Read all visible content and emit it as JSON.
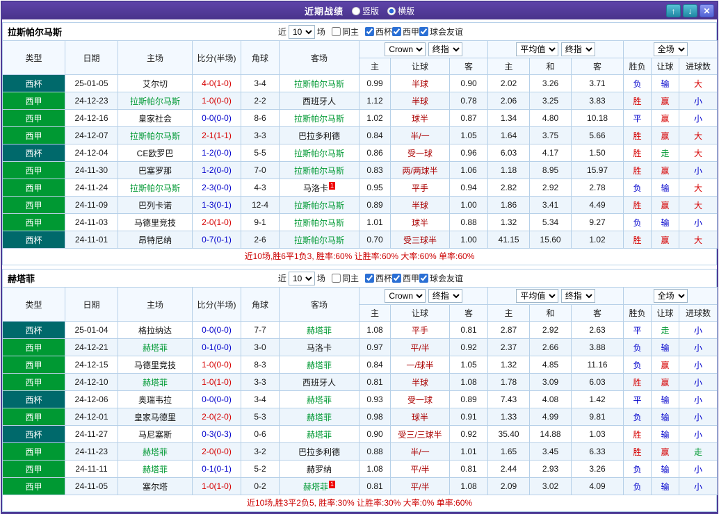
{
  "topbar": {
    "title": "近期战绩",
    "vertical_label": "竖版",
    "horizontal_label": "横版",
    "selected_layout": "横版",
    "up_icon": "↑",
    "down_icon": "↓",
    "close_icon": "✕"
  },
  "controls": {
    "near_label": "近",
    "count": "10",
    "matches_label": "场",
    "same_home_label": "同主",
    "filter_labels": [
      "西杯",
      "西甲",
      "球会友谊"
    ]
  },
  "table_header": {
    "type": "类型",
    "date": "日期",
    "home": "主场",
    "score": "比分(半场)",
    "corners": "角球",
    "away": "客场",
    "company": "Crown",
    "final": "终指",
    "average": "平均值",
    "fulltime": "全场",
    "sub_columns": [
      "主",
      "让球",
      "客",
      "主",
      "和",
      "客",
      "胜负",
      "让球",
      "进球数"
    ]
  },
  "colors": {
    "topbar_purple": "#52399b",
    "cup_badge": "#00696b",
    "liga_badge": "#009933",
    "focal_team": "#009933",
    "win_red": "#d60000",
    "loss_blue": "#0000cc",
    "push_green": "#009933",
    "handicap_red": "#aa0000",
    "row_alt": "#edf5fc",
    "grid": "#b6d0e8"
  },
  "sections": [
    {
      "team": "拉斯帕尔马斯",
      "summary": "近10场,胜6平1负3, 胜率:60% 让胜率:60% 大率:60% 单率:60%",
      "rows": [
        {
          "type": "西杯",
          "league": "cup",
          "date": "25-01-05",
          "home": "艾尔切",
          "home_focal": false,
          "score": "4-0(1-0)",
          "score_color": "red",
          "corners": "3-4",
          "away": "拉斯帕尔马斯",
          "away_focal": true,
          "odds": [
            "0.99",
            "半球",
            "0.90",
            "2.02",
            "3.26",
            "3.71"
          ],
          "results": [
            [
              "负",
              "blue"
            ],
            [
              "输",
              "blue"
            ],
            [
              "大",
              "red"
            ]
          ]
        },
        {
          "type": "西甲",
          "league": "liga",
          "date": "24-12-23",
          "home": "拉斯帕尔马斯",
          "home_focal": true,
          "score": "1-0(0-0)",
          "score_color": "red",
          "corners": "2-2",
          "away": "西班牙人",
          "away_focal": false,
          "odds": [
            "1.12",
            "半球",
            "0.78",
            "2.06",
            "3.25",
            "3.83"
          ],
          "results": [
            [
              "胜",
              "red"
            ],
            [
              "赢",
              "red"
            ],
            [
              "小",
              "blue"
            ]
          ]
        },
        {
          "type": "西甲",
          "league": "liga",
          "date": "24-12-16",
          "home": "皇家社会",
          "home_focal": false,
          "score": "0-0(0-0)",
          "score_color": "blue",
          "corners": "8-6",
          "away": "拉斯帕尔马斯",
          "away_focal": true,
          "odds": [
            "1.02",
            "球半",
            "0.87",
            "1.34",
            "4.80",
            "10.18"
          ],
          "results": [
            [
              "平",
              "blue"
            ],
            [
              "赢",
              "red"
            ],
            [
              "小",
              "blue"
            ]
          ]
        },
        {
          "type": "西甲",
          "league": "liga",
          "date": "24-12-07",
          "home": "拉斯帕尔马斯",
          "home_focal": true,
          "score": "2-1(1-1)",
          "score_color": "red",
          "corners": "3-3",
          "away": "巴拉多利德",
          "away_focal": false,
          "odds": [
            "0.84",
            "半/一",
            "1.05",
            "1.64",
            "3.75",
            "5.66"
          ],
          "results": [
            [
              "胜",
              "red"
            ],
            [
              "赢",
              "red"
            ],
            [
              "大",
              "red"
            ]
          ]
        },
        {
          "type": "西杯",
          "league": "cup",
          "date": "24-12-04",
          "home": "CE欧罗巴",
          "home_focal": false,
          "score": "1-2(0-0)",
          "score_color": "blue",
          "corners": "5-5",
          "away": "拉斯帕尔马斯",
          "away_focal": true,
          "odds": [
            "0.86",
            "受一球",
            "0.96",
            "6.03",
            "4.17",
            "1.50"
          ],
          "results": [
            [
              "胜",
              "red"
            ],
            [
              "走",
              "green"
            ],
            [
              "大",
              "red"
            ]
          ]
        },
        {
          "type": "西甲",
          "league": "liga",
          "date": "24-11-30",
          "home": "巴塞罗那",
          "home_focal": false,
          "score": "1-2(0-0)",
          "score_color": "blue",
          "corners": "7-0",
          "away": "拉斯帕尔马斯",
          "away_focal": true,
          "odds": [
            "0.83",
            "两/两球半",
            "1.06",
            "1.18",
            "8.95",
            "15.97"
          ],
          "results": [
            [
              "胜",
              "red"
            ],
            [
              "赢",
              "red"
            ],
            [
              "小",
              "blue"
            ]
          ]
        },
        {
          "type": "西甲",
          "league": "liga",
          "date": "24-11-24",
          "home": "拉斯帕尔马斯",
          "home_focal": true,
          "score": "2-3(0-0)",
          "score_color": "blue",
          "corners": "4-3",
          "away": "马洛卡",
          "away_focal": false,
          "away_red": "1",
          "odds": [
            "0.95",
            "平手",
            "0.94",
            "2.82",
            "2.92",
            "2.78"
          ],
          "results": [
            [
              "负",
              "blue"
            ],
            [
              "输",
              "blue"
            ],
            [
              "大",
              "red"
            ]
          ]
        },
        {
          "type": "西甲",
          "league": "liga",
          "date": "24-11-09",
          "home": "巴列卡诺",
          "home_focal": false,
          "score": "1-3(0-1)",
          "score_color": "blue",
          "corners": "12-4",
          "away": "拉斯帕尔马斯",
          "away_focal": true,
          "odds": [
            "0.89",
            "半球",
            "1.00",
            "1.86",
            "3.41",
            "4.49"
          ],
          "results": [
            [
              "胜",
              "red"
            ],
            [
              "赢",
              "red"
            ],
            [
              "大",
              "red"
            ]
          ]
        },
        {
          "type": "西甲",
          "league": "liga",
          "date": "24-11-03",
          "home": "马德里竞技",
          "home_focal": false,
          "score": "2-0(1-0)",
          "score_color": "red",
          "corners": "9-1",
          "away": "拉斯帕尔马斯",
          "away_focal": true,
          "odds": [
            "1.01",
            "球半",
            "0.88",
            "1.32",
            "5.34",
            "9.27"
          ],
          "results": [
            [
              "负",
              "blue"
            ],
            [
              "输",
              "blue"
            ],
            [
              "小",
              "blue"
            ]
          ]
        },
        {
          "type": "西杯",
          "league": "cup",
          "date": "24-11-01",
          "home": "昂特尼纳",
          "home_focal": false,
          "score": "0-7(0-1)",
          "score_color": "blue",
          "corners": "2-6",
          "away": "拉斯帕尔马斯",
          "away_focal": true,
          "odds": [
            "0.70",
            "受三球半",
            "1.00",
            "41.15",
            "15.60",
            "1.02"
          ],
          "results": [
            [
              "胜",
              "red"
            ],
            [
              "赢",
              "red"
            ],
            [
              "大",
              "red"
            ]
          ]
        }
      ]
    },
    {
      "team": "赫塔菲",
      "summary": "近10场,胜3平2负5, 胜率:30% 让胜率:30% 大率:0% 单率:60%",
      "rows": [
        {
          "type": "西杯",
          "league": "cup",
          "date": "25-01-04",
          "home": "格拉纳达",
          "home_focal": false,
          "score": "0-0(0-0)",
          "score_color": "blue",
          "corners": "7-7",
          "away": "赫塔菲",
          "away_focal": true,
          "odds": [
            "1.08",
            "平手",
            "0.81",
            "2.87",
            "2.92",
            "2.63"
          ],
          "results": [
            [
              "平",
              "blue"
            ],
            [
              "走",
              "green"
            ],
            [
              "小",
              "blue"
            ]
          ]
        },
        {
          "type": "西甲",
          "league": "liga",
          "date": "24-12-21",
          "home": "赫塔菲",
          "home_focal": true,
          "score": "0-1(0-0)",
          "score_color": "blue",
          "corners": "3-0",
          "away": "马洛卡",
          "away_focal": false,
          "odds": [
            "0.97",
            "平/半",
            "0.92",
            "2.37",
            "2.66",
            "3.88"
          ],
          "results": [
            [
              "负",
              "blue"
            ],
            [
              "输",
              "blue"
            ],
            [
              "小",
              "blue"
            ]
          ]
        },
        {
          "type": "西甲",
          "league": "liga",
          "date": "24-12-15",
          "home": "马德里竞技",
          "home_focal": false,
          "score": "1-0(0-0)",
          "score_color": "red",
          "corners": "8-3",
          "away": "赫塔菲",
          "away_focal": true,
          "odds": [
            "0.84",
            "一/球半",
            "1.05",
            "1.32",
            "4.85",
            "11.16"
          ],
          "results": [
            [
              "负",
              "blue"
            ],
            [
              "赢",
              "red"
            ],
            [
              "小",
              "blue"
            ]
          ]
        },
        {
          "type": "西甲",
          "league": "liga",
          "date": "24-12-10",
          "home": "赫塔菲",
          "home_focal": true,
          "score": "1-0(1-0)",
          "score_color": "red",
          "corners": "3-3",
          "away": "西班牙人",
          "away_focal": false,
          "odds": [
            "0.81",
            "半球",
            "1.08",
            "1.78",
            "3.09",
            "6.03"
          ],
          "results": [
            [
              "胜",
              "red"
            ],
            [
              "赢",
              "red"
            ],
            [
              "小",
              "blue"
            ]
          ]
        },
        {
          "type": "西杯",
          "league": "cup",
          "date": "24-12-06",
          "home": "奥瑞韦拉",
          "home_focal": false,
          "score": "0-0(0-0)",
          "score_color": "blue",
          "corners": "3-4",
          "away": "赫塔菲",
          "away_focal": true,
          "odds": [
            "0.93",
            "受一球",
            "0.89",
            "7.43",
            "4.08",
            "1.42"
          ],
          "results": [
            [
              "平",
              "blue"
            ],
            [
              "输",
              "blue"
            ],
            [
              "小",
              "blue"
            ]
          ]
        },
        {
          "type": "西甲",
          "league": "liga",
          "date": "24-12-01",
          "home": "皇家马德里",
          "home_focal": false,
          "score": "2-0(2-0)",
          "score_color": "red",
          "corners": "5-3",
          "away": "赫塔菲",
          "away_focal": true,
          "odds": [
            "0.98",
            "球半",
            "0.91",
            "1.33",
            "4.99",
            "9.81"
          ],
          "results": [
            [
              "负",
              "blue"
            ],
            [
              "输",
              "blue"
            ],
            [
              "小",
              "blue"
            ]
          ]
        },
        {
          "type": "西杯",
          "league": "cup",
          "date": "24-11-27",
          "home": "马尼塞斯",
          "home_focal": false,
          "score": "0-3(0-3)",
          "score_color": "blue",
          "corners": "0-6",
          "away": "赫塔菲",
          "away_focal": true,
          "odds": [
            "0.90",
            "受三/三球半",
            "0.92",
            "35.40",
            "14.88",
            "1.03"
          ],
          "results": [
            [
              "胜",
              "red"
            ],
            [
              "输",
              "blue"
            ],
            [
              "小",
              "blue"
            ]
          ]
        },
        {
          "type": "西甲",
          "league": "liga",
          "date": "24-11-23",
          "home": "赫塔菲",
          "home_focal": true,
          "score": "2-0(0-0)",
          "score_color": "red",
          "corners": "3-2",
          "away": "巴拉多利德",
          "away_focal": false,
          "odds": [
            "0.88",
            "半/一",
            "1.01",
            "1.65",
            "3.45",
            "6.33"
          ],
          "results": [
            [
              "胜",
              "red"
            ],
            [
              "赢",
              "red"
            ],
            [
              "走",
              "green"
            ]
          ]
        },
        {
          "type": "西甲",
          "league": "liga",
          "date": "24-11-11",
          "home": "赫塔菲",
          "home_focal": true,
          "score": "0-1(0-1)",
          "score_color": "blue",
          "corners": "5-2",
          "away": "赫罗纳",
          "away_focal": false,
          "odds": [
            "1.08",
            "平/半",
            "0.81",
            "2.44",
            "2.93",
            "3.26"
          ],
          "results": [
            [
              "负",
              "blue"
            ],
            [
              "输",
              "blue"
            ],
            [
              "小",
              "blue"
            ]
          ]
        },
        {
          "type": "西甲",
          "league": "liga",
          "date": "24-11-05",
          "home": "塞尔塔",
          "home_focal": false,
          "score": "1-0(1-0)",
          "score_color": "red",
          "corners": "0-2",
          "away": "赫塔菲",
          "away_focal": true,
          "away_red": "1",
          "odds": [
            "0.81",
            "平/半",
            "1.08",
            "2.09",
            "3.02",
            "4.09"
          ],
          "results": [
            [
              "负",
              "blue"
            ],
            [
              "输",
              "blue"
            ],
            [
              "小",
              "blue"
            ]
          ]
        }
      ]
    }
  ]
}
